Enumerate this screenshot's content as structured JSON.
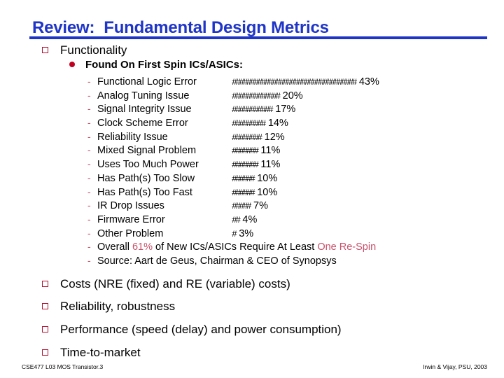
{
  "slide": {
    "title": "Review:  Fundamental Design Metrics",
    "accent_color": "#1f35c8",
    "bullet_color": "#b01030",
    "highlight_color": "#c8506a"
  },
  "level1": {
    "functionality": "Functionality",
    "costs": "Costs (NRE (fixed) and RE (variable) costs)",
    "reliability": "Reliability, robustness",
    "performance": "Performance (speed (delay) and power consumption)",
    "time_to_market": "Time-to-market"
  },
  "level2": {
    "found_on_first_spin": "Found On First Spin ICs/ASICs:"
  },
  "chart_data": {
    "type": "bar",
    "title": "Found On First Spin ICs/ASICs:",
    "xlabel": "",
    "ylabel": "",
    "orientation": "horizontal",
    "unit": "%",
    "glyph": "#",
    "units_per_glyph": 1.27,
    "categories": [
      "Functional Logic Error",
      "Analog Tuning Issue",
      "Signal Integrity Issue",
      "Clock Scheme Error",
      "Reliability Issue",
      "Mixed Signal Problem",
      "Uses Too Much Power",
      "Has Path(s) Too Slow",
      "Has Path(s) Too Fast",
      "IR Drop Issues",
      "Firmware Error",
      "Other Problem"
    ],
    "values": [
      43,
      20,
      17,
      14,
      12,
      11,
      11,
      10,
      10,
      7,
      4,
      3
    ],
    "value_labels": [
      "43%",
      "20%",
      "17%",
      "14%",
      "12%",
      "11%",
      "11%",
      "10%",
      "10%",
      "7%",
      "4%",
      "3%"
    ],
    "bars": [
      "##################################",
      "#############",
      "###########",
      "#########",
      "########",
      "#######",
      "#######",
      "######",
      "######",
      "#####",
      "##",
      "#"
    ],
    "glyph_counts": [
      34,
      13,
      11,
      9,
      8,
      7,
      7,
      6,
      6,
      5,
      2,
      1
    ],
    "xlim": [
      0,
      43
    ],
    "grid": false,
    "legend": null,
    "annotations": [
      "Overall 61% of New ICs/ASICs Require At Least One Re-Spin",
      "Source: Aart de Geus, Chairman & CEO of Synopsys"
    ]
  },
  "notes": {
    "overall_prefix": "Overall ",
    "overall_pct": "61%",
    "overall_mid": " of New ICs/ASICs Require At Least ",
    "overall_suffix": "One Re-Spin",
    "source": "Source: Aart de Geus, Chairman & CEO of Synopsys",
    "dash": "-"
  },
  "footer": {
    "left": "CSE477  L03 MOS Transistor.3",
    "right": "Irwin & Vijay, PSU, 2003"
  }
}
